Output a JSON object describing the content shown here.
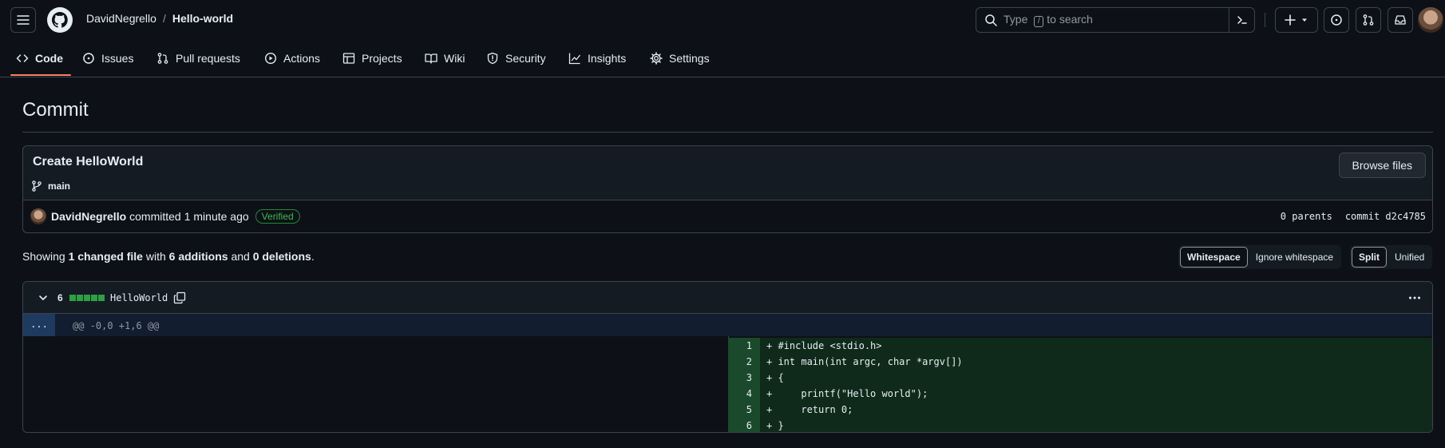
{
  "header": {
    "owner": "DavidNegrello",
    "separator": "/",
    "repo": "Hello-world",
    "search": {
      "prefix": "Type",
      "kbd": "/",
      "suffix": "to search"
    }
  },
  "tabs": [
    {
      "label": "Code",
      "icon": "code-icon",
      "active": true
    },
    {
      "label": "Issues",
      "icon": "issue-icon"
    },
    {
      "label": "Pull requests",
      "icon": "pull-request-icon"
    },
    {
      "label": "Actions",
      "icon": "play-icon"
    },
    {
      "label": "Projects",
      "icon": "table-icon"
    },
    {
      "label": "Wiki",
      "icon": "book-icon"
    },
    {
      "label": "Security",
      "icon": "shield-icon"
    },
    {
      "label": "Insights",
      "icon": "graph-icon"
    },
    {
      "label": "Settings",
      "icon": "gear-icon"
    }
  ],
  "page": {
    "title": "Commit"
  },
  "commit": {
    "message": "Create HelloWorld",
    "branch": "main",
    "browse_label": "Browse files",
    "author": "DavidNegrello",
    "action": "committed",
    "time": "1 minute ago",
    "badge": "Verified",
    "parents": "0 parents",
    "commit_label": "commit",
    "sha": "d2c4785"
  },
  "summary": {
    "showing": "Showing",
    "changed": "1 changed file",
    "with": "with",
    "additions": "6 additions",
    "and": "and",
    "deletions": "0 deletions",
    "end": "."
  },
  "view_options": {
    "whitespace": "Whitespace",
    "ignore_whitespace": "Ignore whitespace",
    "split": "Split",
    "unified": "Unified"
  },
  "file": {
    "count": "6",
    "name": "HelloWorld",
    "diffstat_added": 5,
    "hunk_expand": "...",
    "hunk_header": "@@ -0,0 +1,6 @@",
    "lines": [
      {
        "num": "1",
        "text": "+ #include <stdio.h>"
      },
      {
        "num": "2",
        "text": "+ int main(int argc, char *argv[])"
      },
      {
        "num": "3",
        "text": "+ {"
      },
      {
        "num": "4",
        "text": "+     printf(\"Hello world\");"
      },
      {
        "num": "5",
        "text": "+     return 0;"
      },
      {
        "num": "6",
        "text": "+ }"
      }
    ]
  },
  "colors": {
    "background": "#0d1117",
    "border": "#3d444d",
    "accent_underline": "#f78166",
    "added_line_bg": "#0f2a1a",
    "added_num_bg": "#1a4a2b",
    "verified": "#3fb950"
  }
}
